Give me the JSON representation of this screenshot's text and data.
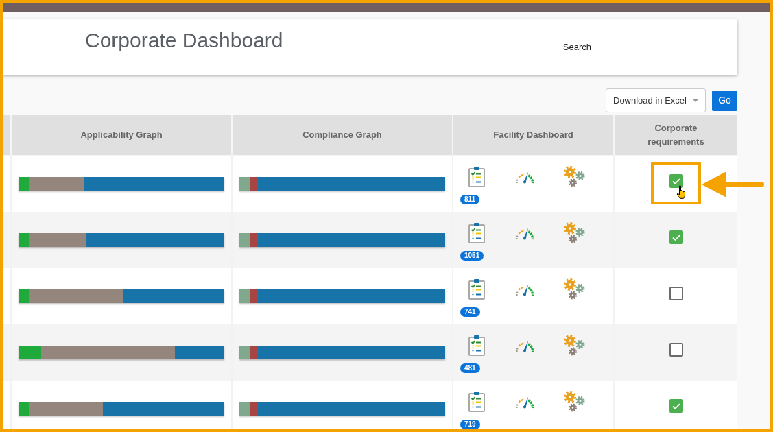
{
  "header": {
    "title": "Corporate Dashboard",
    "search": {
      "label": "Search"
    }
  },
  "toolbar": {
    "export_format": "Download in Excel",
    "go_button": "Go"
  },
  "table": {
    "columns": [
      "Applicability Graph",
      "Compliance Graph",
      "Facility Dashboard",
      "Corporate requirements"
    ],
    "rows": [
      {
        "applicability": [
          {
            "level": 0.05,
            "color": "#1fab3b"
          },
          {
            "level": 0.32,
            "color": "#94867d"
          }
        ],
        "compliance": [
          {
            "level": 0.05,
            "color": "#7fa88f"
          },
          {
            "level": 0.09,
            "color": "#a84442"
          }
        ],
        "facility_badge": "811",
        "corporate_requirement": {
          "checked": true,
          "highlighted": true
        }
      },
      {
        "applicability": [
          {
            "level": 0.05,
            "color": "#1fab3b"
          },
          {
            "level": 0.33,
            "color": "#94867d"
          }
        ],
        "compliance": [
          {
            "level": 0.05,
            "color": "#7fa88f"
          },
          {
            "level": 0.09,
            "color": "#a84442"
          }
        ],
        "facility_badge": "1051",
        "corporate_requirement": {
          "checked": true,
          "highlighted": false
        }
      },
      {
        "applicability": [
          {
            "level": 0.05,
            "color": "#1fab3b"
          },
          {
            "level": 0.51,
            "color": "#94867d"
          }
        ],
        "compliance": [
          {
            "level": 0.05,
            "color": "#7fa88f"
          },
          {
            "level": 0.09,
            "color": "#a84442"
          }
        ],
        "facility_badge": "741",
        "corporate_requirement": {
          "checked": false,
          "highlighted": false
        }
      },
      {
        "applicability": [
          {
            "level": 0.11,
            "color": "#1fab3b"
          },
          {
            "level": 0.76,
            "color": "#94867d"
          }
        ],
        "compliance": [
          {
            "level": 0.05,
            "color": "#7fa88f"
          },
          {
            "level": 0.09,
            "color": "#a84442"
          }
        ],
        "facility_badge": "481",
        "corporate_requirement": {
          "checked": false,
          "highlighted": false
        }
      },
      {
        "applicability": [
          {
            "level": 0.05,
            "color": "#1fab3b"
          },
          {
            "level": 0.41,
            "color": "#94867d"
          }
        ],
        "compliance": [
          {
            "level": 0.05,
            "color": "#7fa88f"
          },
          {
            "level": 0.09,
            "color": "#a84442"
          }
        ],
        "facility_badge": "719",
        "corporate_requirement": {
          "checked": true,
          "highlighted": false
        }
      }
    ]
  }
}
